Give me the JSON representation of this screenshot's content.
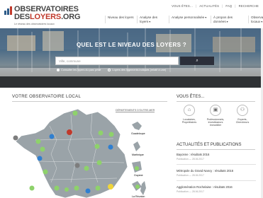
{
  "topbar": {
    "links": [
      "VOUS ÊTES...",
      "ACTUALITÉS",
      "FAQ",
      "RECHERCHE"
    ]
  },
  "logo": {
    "line1": "OBSERVATOIRES",
    "line2a": "DES",
    "line2b": "LOYERS",
    "line2c": ".ORG",
    "tagline": "Le réseau des observatoires locaux"
  },
  "nav": {
    "items": [
      {
        "label": "Niveau des loyers"
      },
      {
        "label": "Analyse des loyers"
      },
      {
        "label": "Analyse personnalisée"
      },
      {
        "label": "À propos des données"
      },
      {
        "label": "Observatoires locaux"
      }
    ]
  },
  "hero": {
    "title": "QUEL EST LE NIVEAU DES LOYERS ?",
    "search_placeholder": "Ville, commune",
    "search_button_icon": "search-icon",
    "radio1": "Consulter les loyers du parc privé",
    "radio2": "Loyers des logements indiqués (relatif à une)"
  },
  "left": {
    "title": "VOTRE OBSERVATOIRE LOCAL",
    "dom_header": "DÉPARTEMENTS D'OUTRE-MER",
    "dom": [
      "Guadeloupe",
      "Martinique",
      "Guyane",
      "La Réunion"
    ]
  },
  "right": {
    "vous_title": "VOUS ÊTES...",
    "vous_items": [
      {
        "line1": "Locataires,",
        "line2": "Propriétaires",
        "icon": "home-icon"
      },
      {
        "line1": "Professionnels,",
        "line2": "investisseurs",
        "line3": "immobilier",
        "icon": "briefcase-icon"
      },
      {
        "line1": "Experts,",
        "line2": "Chercheurs",
        "icon": "graph-icon"
      }
    ],
    "news_title": "ACTUALITÉS ET PUBLICATIONS",
    "news": [
      {
        "title": "Bayonne : résultats 2016",
        "date": "Publication — 28.06.2017"
      },
      {
        "title": "Métropole du Grand Nancy : résultats 2016",
        "date": "Publication — 28.06.2017"
      },
      {
        "title": "Agglomération Rochelaise : résultats 2016",
        "date": "Publication — 28.06.2017"
      }
    ]
  },
  "colors": {
    "pin_green": "#8ed26b",
    "pin_blue": "#2f7fd0",
    "pin_red": "#c0392b",
    "pin_yellow": "#f0d53a",
    "pin_gray": "#7d7d7d",
    "map_land": "#9aa3a8",
    "hero_button": "#2b2f3a"
  }
}
